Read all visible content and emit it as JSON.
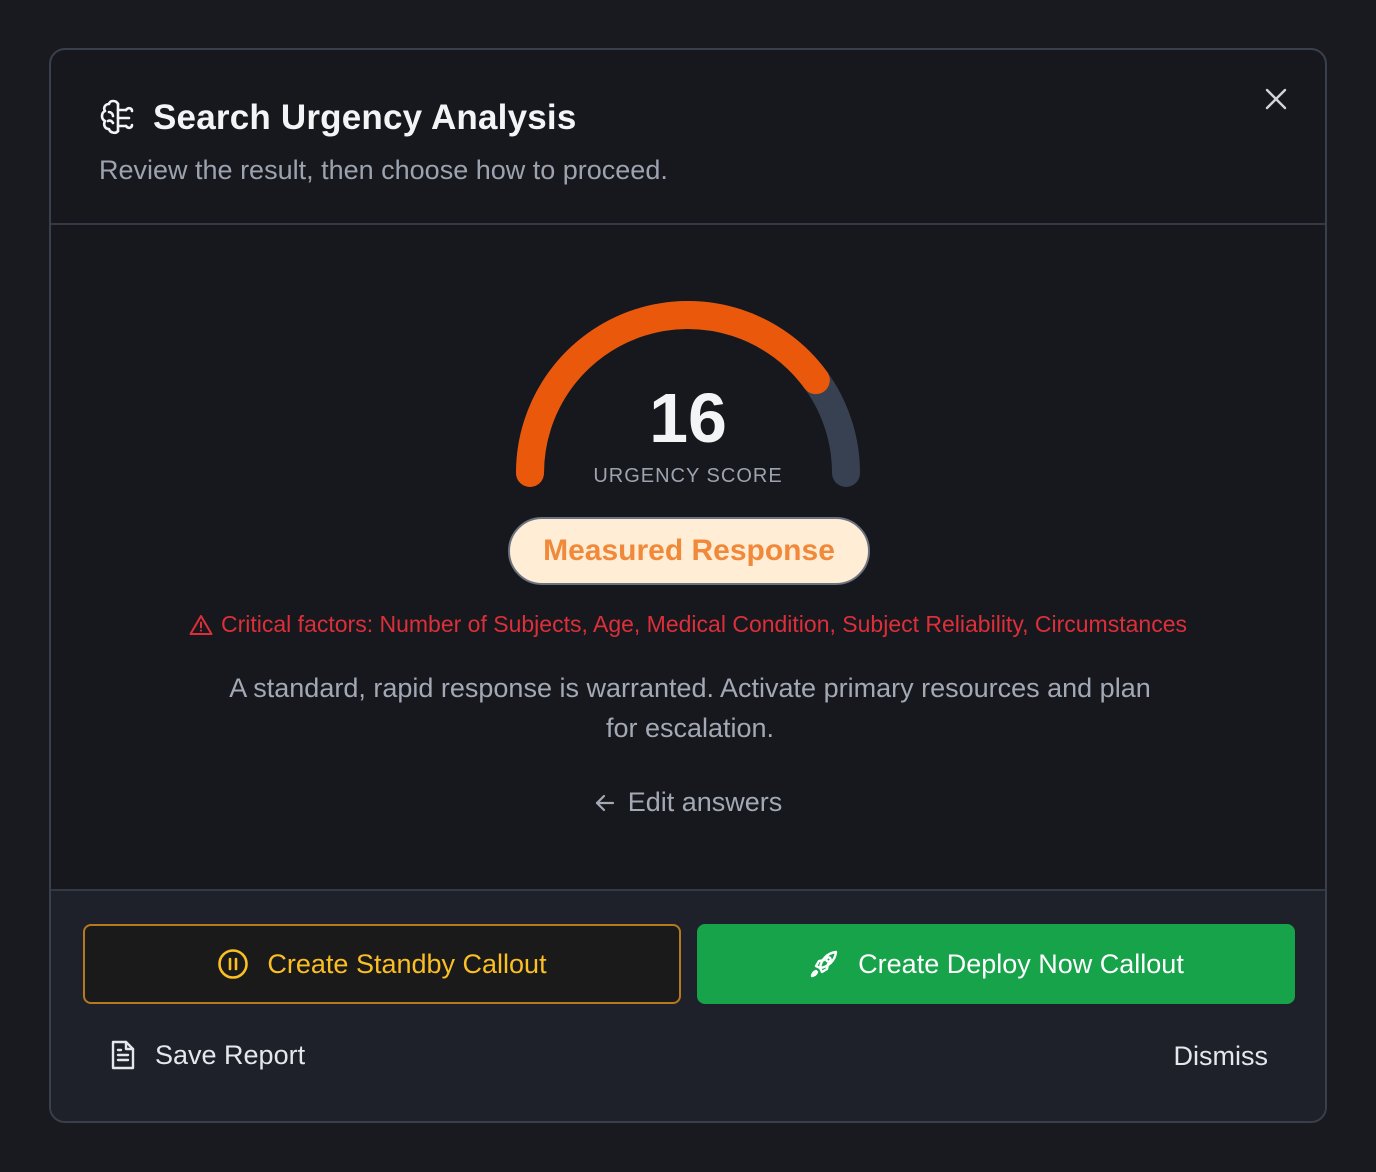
{
  "header": {
    "title": "Search Urgency Analysis",
    "subtitle": "Review the result, then choose how to proceed.",
    "icon": "brain-icon",
    "close_icon": "close-icon"
  },
  "result": {
    "score": "16",
    "score_label": "URGENCY SCORE",
    "gauge_fraction": 0.8,
    "badge": "Measured Response",
    "critical_factors": "Critical factors: Number of Subjects, Age, Medical Condition, Subject Reliability, Circumstances",
    "description": "A standard, rapid response is warranted. Activate primary resources and plan for escalation.",
    "edit_link": "Edit answers"
  },
  "footer": {
    "standby_button": "Create Standby Callout",
    "deploy_button": "Create Deploy Now Callout",
    "save_report": "Save Report",
    "dismiss": "Dismiss"
  },
  "colors": {
    "gauge_fill": "#ea580c",
    "gauge_track": "#374151",
    "badge_bg": "#ffedd5",
    "badge_text": "#f0893a",
    "critical": "#dc2f3a",
    "standby": "#fbbf24",
    "deploy": "#16a34a"
  }
}
